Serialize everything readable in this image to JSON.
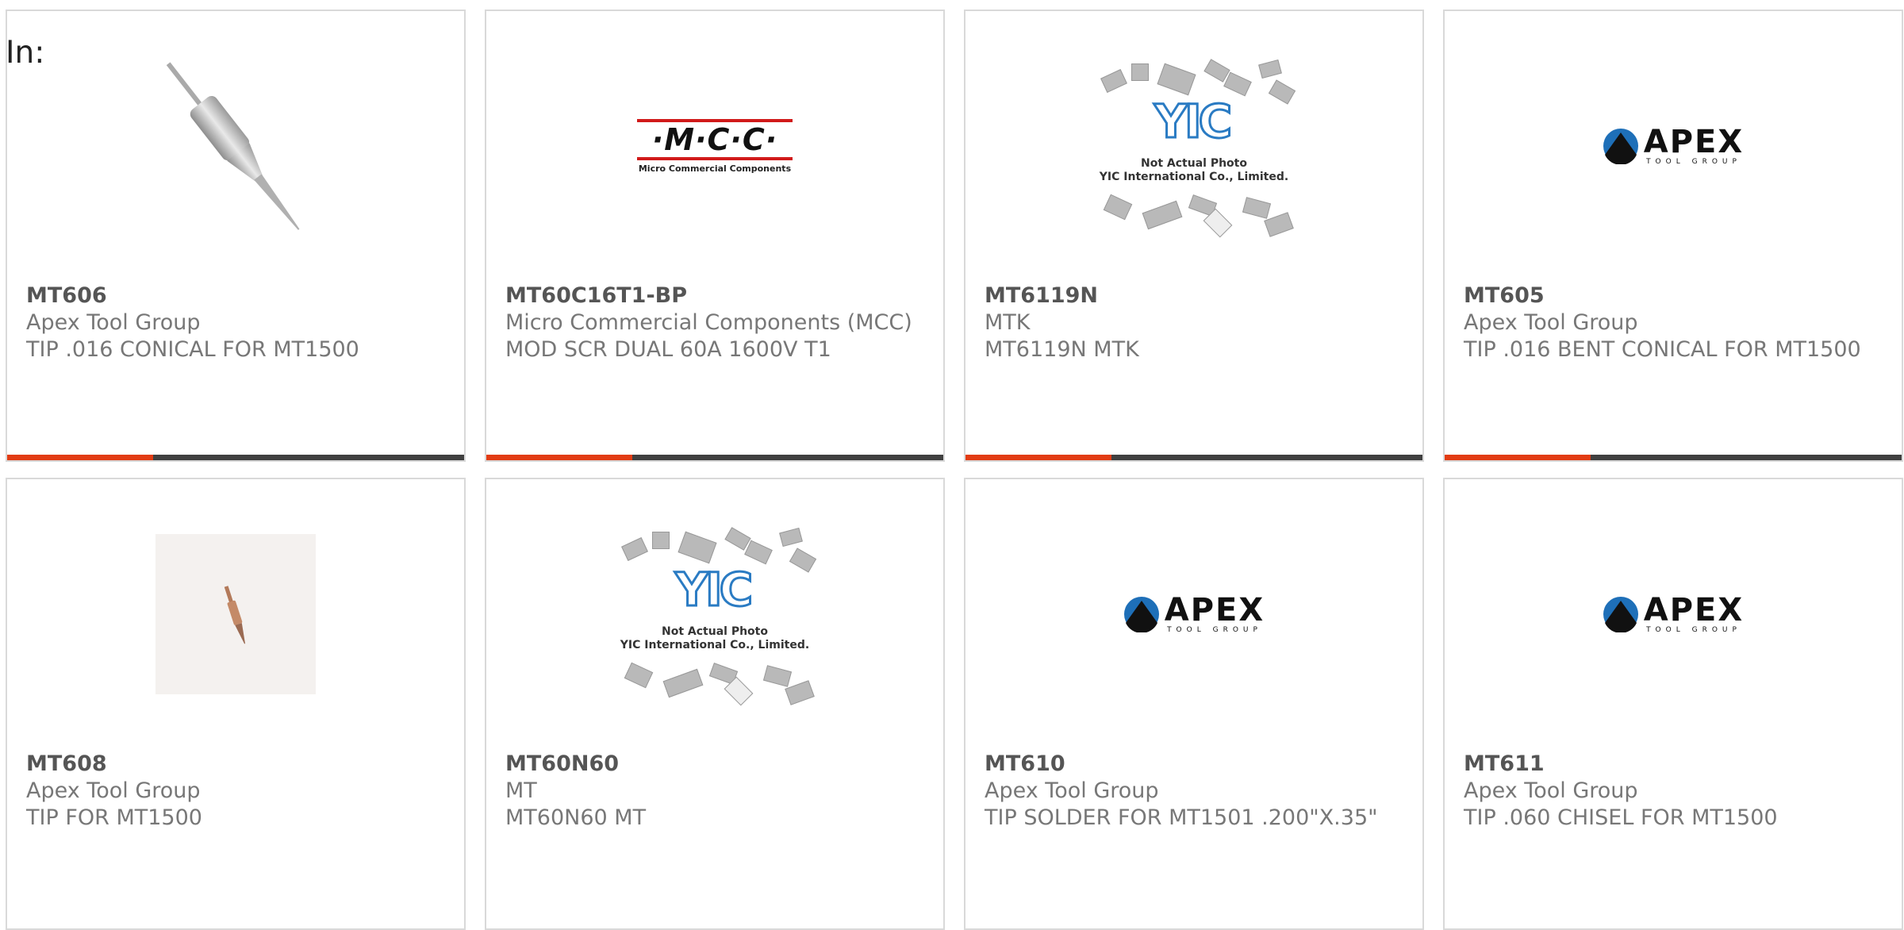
{
  "filter_label": "In:",
  "products": [
    {
      "part": "MT606",
      "manufacturer": "Apex Tool Group",
      "description": "TIP .016 CONICAL FOR MT1500",
      "image": "soldering-tip-photo"
    },
    {
      "part": "MT60C16T1-BP",
      "manufacturer": "Micro Commercial Components (MCC)",
      "description": "MOD SCR DUAL 60A 1600V T1",
      "image": "mcc-logo"
    },
    {
      "part": "MT6119N",
      "manufacturer": "MTK",
      "description": "MT6119N MTK",
      "image": "yic-placeholder"
    },
    {
      "part": "MT605",
      "manufacturer": "Apex Tool Group",
      "description": "TIP .016 BENT CONICAL FOR MT1500",
      "image": "apex-logo"
    },
    {
      "part": "MT608",
      "manufacturer": "Apex Tool Group",
      "description": "TIP FOR MT1500",
      "image": "small-tip-photo"
    },
    {
      "part": "MT60N60",
      "manufacturer": "MT",
      "description": "MT60N60 MT",
      "image": "yic-placeholder"
    },
    {
      "part": "MT610",
      "manufacturer": "Apex Tool Group",
      "description": "TIP SOLDER FOR MT1501 .200\"X.35\"",
      "image": "apex-logo"
    },
    {
      "part": "MT611",
      "manufacturer": "Apex Tool Group",
      "description": "TIP .060 CHISEL FOR MT1500",
      "image": "apex-logo"
    }
  ],
  "logos": {
    "mcc_mark": "·M·C·C·",
    "mcc_tagline": "Micro Commercial Components",
    "apex_mark": "APEX",
    "apex_tagline": "TOOL GROUP",
    "yic_mark": "YIC",
    "yic_caption_1": "Not Actual Photo",
    "yic_caption_2": "YIC International Co., Limited."
  },
  "colors": {
    "accent": "#e23c13",
    "bar_dark": "#404040",
    "card_border": "#d9d9d9",
    "yic_blue": "#2a7bc3",
    "mcc_red": "#d11a1a"
  }
}
